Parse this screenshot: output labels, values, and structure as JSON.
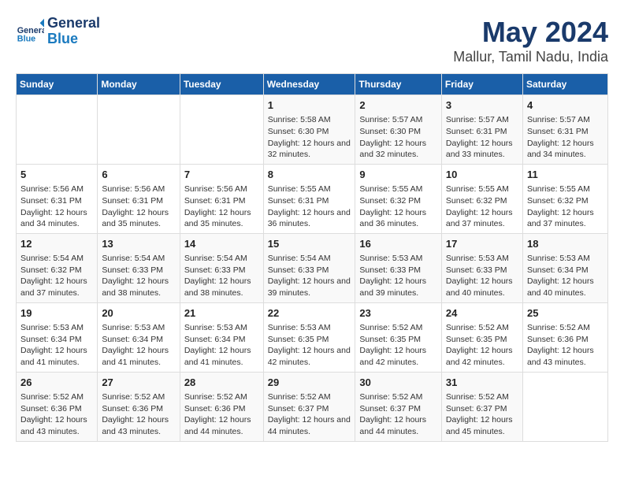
{
  "header": {
    "logo_general": "General",
    "logo_blue": "Blue",
    "title": "May 2024",
    "subtitle": "Mallur, Tamil Nadu, India"
  },
  "days_of_week": [
    "Sunday",
    "Monday",
    "Tuesday",
    "Wednesday",
    "Thursday",
    "Friday",
    "Saturday"
  ],
  "weeks": [
    {
      "cells": [
        {
          "day": null,
          "info": null
        },
        {
          "day": null,
          "info": null
        },
        {
          "day": null,
          "info": null
        },
        {
          "day": "1",
          "sunrise": "Sunrise: 5:58 AM",
          "sunset": "Sunset: 6:30 PM",
          "daylight": "Daylight: 12 hours and 32 minutes."
        },
        {
          "day": "2",
          "sunrise": "Sunrise: 5:57 AM",
          "sunset": "Sunset: 6:30 PM",
          "daylight": "Daylight: 12 hours and 32 minutes."
        },
        {
          "day": "3",
          "sunrise": "Sunrise: 5:57 AM",
          "sunset": "Sunset: 6:31 PM",
          "daylight": "Daylight: 12 hours and 33 minutes."
        },
        {
          "day": "4",
          "sunrise": "Sunrise: 5:57 AM",
          "sunset": "Sunset: 6:31 PM",
          "daylight": "Daylight: 12 hours and 34 minutes."
        }
      ]
    },
    {
      "cells": [
        {
          "day": "5",
          "sunrise": "Sunrise: 5:56 AM",
          "sunset": "Sunset: 6:31 PM",
          "daylight": "Daylight: 12 hours and 34 minutes."
        },
        {
          "day": "6",
          "sunrise": "Sunrise: 5:56 AM",
          "sunset": "Sunset: 6:31 PM",
          "daylight": "Daylight: 12 hours and 35 minutes."
        },
        {
          "day": "7",
          "sunrise": "Sunrise: 5:56 AM",
          "sunset": "Sunset: 6:31 PM",
          "daylight": "Daylight: 12 hours and 35 minutes."
        },
        {
          "day": "8",
          "sunrise": "Sunrise: 5:55 AM",
          "sunset": "Sunset: 6:31 PM",
          "daylight": "Daylight: 12 hours and 36 minutes."
        },
        {
          "day": "9",
          "sunrise": "Sunrise: 5:55 AM",
          "sunset": "Sunset: 6:32 PM",
          "daylight": "Daylight: 12 hours and 36 minutes."
        },
        {
          "day": "10",
          "sunrise": "Sunrise: 5:55 AM",
          "sunset": "Sunset: 6:32 PM",
          "daylight": "Daylight: 12 hours and 37 minutes."
        },
        {
          "day": "11",
          "sunrise": "Sunrise: 5:55 AM",
          "sunset": "Sunset: 6:32 PM",
          "daylight": "Daylight: 12 hours and 37 minutes."
        }
      ]
    },
    {
      "cells": [
        {
          "day": "12",
          "sunrise": "Sunrise: 5:54 AM",
          "sunset": "Sunset: 6:32 PM",
          "daylight": "Daylight: 12 hours and 37 minutes."
        },
        {
          "day": "13",
          "sunrise": "Sunrise: 5:54 AM",
          "sunset": "Sunset: 6:33 PM",
          "daylight": "Daylight: 12 hours and 38 minutes."
        },
        {
          "day": "14",
          "sunrise": "Sunrise: 5:54 AM",
          "sunset": "Sunset: 6:33 PM",
          "daylight": "Daylight: 12 hours and 38 minutes."
        },
        {
          "day": "15",
          "sunrise": "Sunrise: 5:54 AM",
          "sunset": "Sunset: 6:33 PM",
          "daylight": "Daylight: 12 hours and 39 minutes."
        },
        {
          "day": "16",
          "sunrise": "Sunrise: 5:53 AM",
          "sunset": "Sunset: 6:33 PM",
          "daylight": "Daylight: 12 hours and 39 minutes."
        },
        {
          "day": "17",
          "sunrise": "Sunrise: 5:53 AM",
          "sunset": "Sunset: 6:33 PM",
          "daylight": "Daylight: 12 hours and 40 minutes."
        },
        {
          "day": "18",
          "sunrise": "Sunrise: 5:53 AM",
          "sunset": "Sunset: 6:34 PM",
          "daylight": "Daylight: 12 hours and 40 minutes."
        }
      ]
    },
    {
      "cells": [
        {
          "day": "19",
          "sunrise": "Sunrise: 5:53 AM",
          "sunset": "Sunset: 6:34 PM",
          "daylight": "Daylight: 12 hours and 41 minutes."
        },
        {
          "day": "20",
          "sunrise": "Sunrise: 5:53 AM",
          "sunset": "Sunset: 6:34 PM",
          "daylight": "Daylight: 12 hours and 41 minutes."
        },
        {
          "day": "21",
          "sunrise": "Sunrise: 5:53 AM",
          "sunset": "Sunset: 6:34 PM",
          "daylight": "Daylight: 12 hours and 41 minutes."
        },
        {
          "day": "22",
          "sunrise": "Sunrise: 5:53 AM",
          "sunset": "Sunset: 6:35 PM",
          "daylight": "Daylight: 12 hours and 42 minutes."
        },
        {
          "day": "23",
          "sunrise": "Sunrise: 5:52 AM",
          "sunset": "Sunset: 6:35 PM",
          "daylight": "Daylight: 12 hours and 42 minutes."
        },
        {
          "day": "24",
          "sunrise": "Sunrise: 5:52 AM",
          "sunset": "Sunset: 6:35 PM",
          "daylight": "Daylight: 12 hours and 42 minutes."
        },
        {
          "day": "25",
          "sunrise": "Sunrise: 5:52 AM",
          "sunset": "Sunset: 6:36 PM",
          "daylight": "Daylight: 12 hours and 43 minutes."
        }
      ]
    },
    {
      "cells": [
        {
          "day": "26",
          "sunrise": "Sunrise: 5:52 AM",
          "sunset": "Sunset: 6:36 PM",
          "daylight": "Daylight: 12 hours and 43 minutes."
        },
        {
          "day": "27",
          "sunrise": "Sunrise: 5:52 AM",
          "sunset": "Sunset: 6:36 PM",
          "daylight": "Daylight: 12 hours and 43 minutes."
        },
        {
          "day": "28",
          "sunrise": "Sunrise: 5:52 AM",
          "sunset": "Sunset: 6:36 PM",
          "daylight": "Daylight: 12 hours and 44 minutes."
        },
        {
          "day": "29",
          "sunrise": "Sunrise: 5:52 AM",
          "sunset": "Sunset: 6:37 PM",
          "daylight": "Daylight: 12 hours and 44 minutes."
        },
        {
          "day": "30",
          "sunrise": "Sunrise: 5:52 AM",
          "sunset": "Sunset: 6:37 PM",
          "daylight": "Daylight: 12 hours and 44 minutes."
        },
        {
          "day": "31",
          "sunrise": "Sunrise: 5:52 AM",
          "sunset": "Sunset: 6:37 PM",
          "daylight": "Daylight: 12 hours and 45 minutes."
        },
        {
          "day": null,
          "info": null
        }
      ]
    }
  ]
}
